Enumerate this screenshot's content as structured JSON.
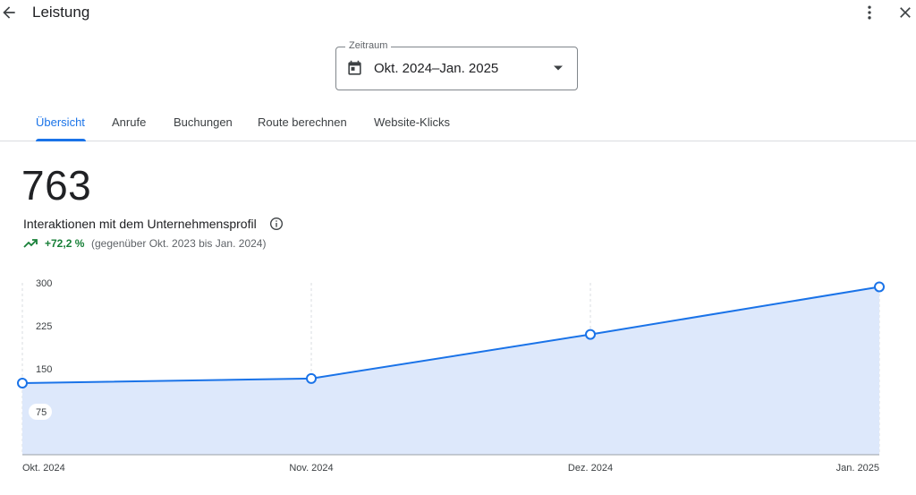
{
  "header": {
    "title": "Leistung",
    "back_icon": "arrow-back-icon",
    "more_icon": "more-vert-icon",
    "close_icon": "close-icon"
  },
  "date_range": {
    "label": "Zeitraum",
    "value": "Okt. 2024–Jan. 2025",
    "icon": "calendar-icon"
  },
  "tabs": [
    {
      "label": "Übersicht",
      "active": true
    },
    {
      "label": "Anrufe",
      "active": false
    },
    {
      "label": "Buchungen",
      "active": false
    },
    {
      "label": "Route berechnen",
      "active": false
    },
    {
      "label": "Website-Klicks",
      "active": false
    }
  ],
  "summary": {
    "total": "763",
    "label": "Interaktionen mit dem Unternehmensprofil",
    "trend_value": "+72,2 %",
    "trend_compare": "(gegenüber Okt. 2023 bis Jan. 2024)"
  },
  "colors": {
    "accent": "#1a73e8",
    "area_fill": "#dde8fb",
    "positive": "#188038"
  },
  "chart_data": {
    "type": "area",
    "categories": [
      "Okt. 2024",
      "Nov. 2024",
      "Dez. 2024",
      "Jan. 2025"
    ],
    "values": [
      125,
      133,
      210,
      293
    ],
    "ylim": [
      0,
      300
    ],
    "yticks": [
      300,
      225,
      150,
      75
    ],
    "grid": "vertical-dashed"
  }
}
